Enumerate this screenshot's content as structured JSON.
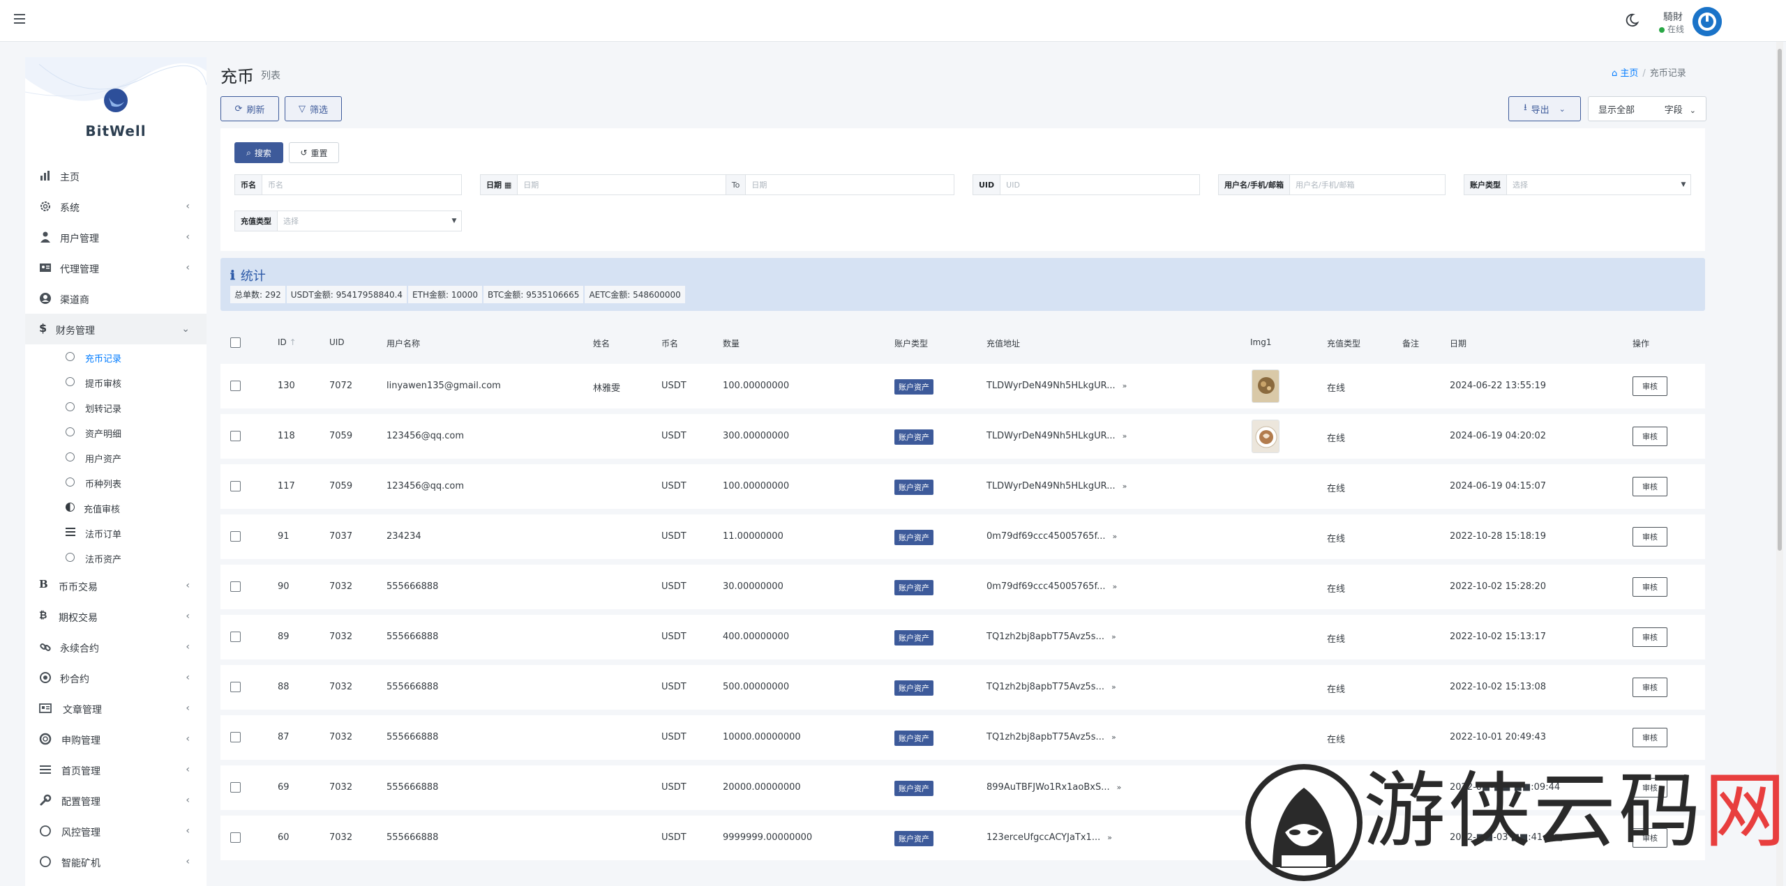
{
  "topbar": {
    "user_name": "騎財",
    "user_status": "在线"
  },
  "sidebar": {
    "logo_text": "BitWell",
    "items": [
      {
        "label": "主页",
        "icon": "bar-chart-icon",
        "chevron": false
      },
      {
        "label": "系统",
        "icon": "gear-icon",
        "chevron": true
      },
      {
        "label": "用户管理",
        "icon": "user-icon",
        "chevron": true
      },
      {
        "label": "代理管理",
        "icon": "id-card-icon",
        "chevron": true
      },
      {
        "label": "渠道商",
        "icon": "user-circle-icon",
        "chevron": false
      },
      {
        "label": "财务管理",
        "icon": "dollar-icon",
        "chevron": true,
        "open": true
      }
    ],
    "sub_items": [
      {
        "label": "充币记录",
        "active": true
      },
      {
        "label": "提币审核"
      },
      {
        "label": "划转记录"
      },
      {
        "label": "资产明细"
      },
      {
        "label": "用户资产"
      },
      {
        "label": "币种列表"
      },
      {
        "label": "充值审核"
      },
      {
        "label": "法币订单"
      },
      {
        "label": "法币资产"
      }
    ],
    "items_after": [
      {
        "label": "币币交易",
        "icon": "b-icon"
      },
      {
        "label": "期权交易",
        "icon": "bitcoin-icon"
      },
      {
        "label": "永续合约",
        "icon": "link-icon"
      },
      {
        "label": "秒合约",
        "icon": "dot-circle-icon"
      },
      {
        "label": "文章管理",
        "icon": "newspaper-icon"
      },
      {
        "label": "申购管理",
        "icon": "life-ring-icon"
      },
      {
        "label": "首页管理",
        "icon": "list-icon"
      },
      {
        "label": "配置管理",
        "icon": "wrench-icon"
      },
      {
        "label": "风控管理",
        "icon": "circle-icon"
      },
      {
        "label": "智能矿机",
        "icon": "circle-icon"
      }
    ]
  },
  "header": {
    "title": "充币",
    "subtitle": "列表",
    "breadcrumb_home": "主页",
    "breadcrumb_current": "充币记录"
  },
  "toolbar": {
    "refresh": "刷新",
    "filter": "筛选",
    "export": "导出",
    "show_all": "显示全部",
    "fields": "字段"
  },
  "filters": {
    "search": "搜索",
    "reset": "重置",
    "coin_label": "币名",
    "coin_placeholder": "币名",
    "date_label": "日期",
    "date_placeholder_from": "日期",
    "date_to": "To",
    "date_placeholder_to": "日期",
    "uid_label": "UID",
    "uid_placeholder": "UID",
    "user_label": "用户名/手机/邮箱",
    "user_placeholder": "用户名/手机/邮箱",
    "account_type_label": "账户类型",
    "account_type_placeholder": "选择",
    "recharge_type_label": "充值类型",
    "recharge_type_placeholder": "选择"
  },
  "stats": {
    "title": "统计",
    "chips": [
      "总单数: 292",
      "USDT金额: 95417958840.4",
      "ETH金额: 10000",
      "BTC金额: 9535106665",
      "AETC金额: 548600000"
    ]
  },
  "table": {
    "headers": {
      "id": "ID",
      "uid": "UID",
      "username": "用户名称",
      "name": "姓名",
      "coin": "币名",
      "amount": "数量",
      "account_type": "账户类型",
      "address": "充值地址",
      "img": "Img1",
      "recharge_type": "充值类型",
      "remark": "备注",
      "date": "日期",
      "action": "操作"
    },
    "rows": [
      {
        "id": "130",
        "uid": "7072",
        "username": "linyawen135@gmail.com",
        "name": "林雅雯",
        "coin": "USDT",
        "amount": "100.00000000",
        "account_type": "账户资产",
        "address": "TLDWyrDeN49Nh5HLkgUR...",
        "img": "food",
        "recharge_type": "在线",
        "date": "2024-06-22 13:55:19",
        "action": "审核"
      },
      {
        "id": "118",
        "uid": "7059",
        "username": "123456@qq.com",
        "name": "",
        "coin": "USDT",
        "amount": "300.00000000",
        "account_type": "账户资产",
        "address": "TLDWyrDeN49Nh5HLkgUR...",
        "img": "latte",
        "recharge_type": "在线",
        "date": "2024-06-19 04:20:02",
        "action": "审核"
      },
      {
        "id": "117",
        "uid": "7059",
        "username": "123456@qq.com",
        "name": "",
        "coin": "USDT",
        "amount": "100.00000000",
        "account_type": "账户资产",
        "address": "TLDWyrDeN49Nh5HLkgUR...",
        "img": "",
        "recharge_type": "在线",
        "date": "2024-06-19 04:15:07",
        "action": "审核"
      },
      {
        "id": "91",
        "uid": "7037",
        "username": "234234",
        "name": "",
        "coin": "USDT",
        "amount": "11.00000000",
        "account_type": "账户资产",
        "address": "0m79df69ccc45005765f...",
        "img": "",
        "recharge_type": "在线",
        "date": "2022-10-28 15:18:19",
        "action": "审核"
      },
      {
        "id": "90",
        "uid": "7032",
        "username": "555666888",
        "name": "",
        "coin": "USDT",
        "amount": "30.00000000",
        "account_type": "账户资产",
        "address": "0m79df69ccc45005765f...",
        "img": "",
        "recharge_type": "在线",
        "date": "2022-10-02 15:28:20",
        "action": "审核"
      },
      {
        "id": "89",
        "uid": "7032",
        "username": "555666888",
        "name": "",
        "coin": "USDT",
        "amount": "400.00000000",
        "account_type": "账户资产",
        "address": "TQ1zh2bj8apbT75Avz5s...",
        "img": "",
        "recharge_type": "在线",
        "date": "2022-10-02 15:13:17",
        "action": "审核"
      },
      {
        "id": "88",
        "uid": "7032",
        "username": "555666888",
        "name": "",
        "coin": "USDT",
        "amount": "500.00000000",
        "account_type": "账户资产",
        "address": "TQ1zh2bj8apbT75Avz5s...",
        "img": "",
        "recharge_type": "在线",
        "date": "2022-10-02 15:13:08",
        "action": "审核"
      },
      {
        "id": "87",
        "uid": "7032",
        "username": "555666888",
        "name": "",
        "coin": "USDT",
        "amount": "10000.00000000",
        "account_type": "账户资产",
        "address": "TQ1zh2bj8apbT75Avz5s...",
        "img": "",
        "recharge_type": "在线",
        "date": "2022-10-01 20:49:43",
        "action": "审核"
      },
      {
        "id": "69",
        "uid": "7032",
        "username": "555666888",
        "name": "",
        "coin": "USDT",
        "amount": "20000.00000000",
        "account_type": "账户资产",
        "address": "899AuTBFJWo1Rx1aoBxS...",
        "img": "",
        "recharge_type": "在线",
        "date": "2022-0■-■■ ■■:09:44",
        "action": "审核"
      },
      {
        "id": "60",
        "uid": "7032",
        "username": "555666888",
        "name": "",
        "coin": "USDT",
        "amount": "9999999.00000000",
        "account_type": "账户资产",
        "address": "123erceUfgccACYJaTx1...",
        "img": "",
        "recharge_type": "在线",
        "date": "2022-■■-03 ■■:41:■■",
        "action": "审核"
      }
    ]
  },
  "watermark": {
    "text_main": "游侠云码",
    "text_red": "网"
  },
  "colors": {
    "primary": "#3d5a9a",
    "stats_bg": "#d6e2f3",
    "page_bg": "#f4f6f9",
    "active_link": "#007bff"
  }
}
